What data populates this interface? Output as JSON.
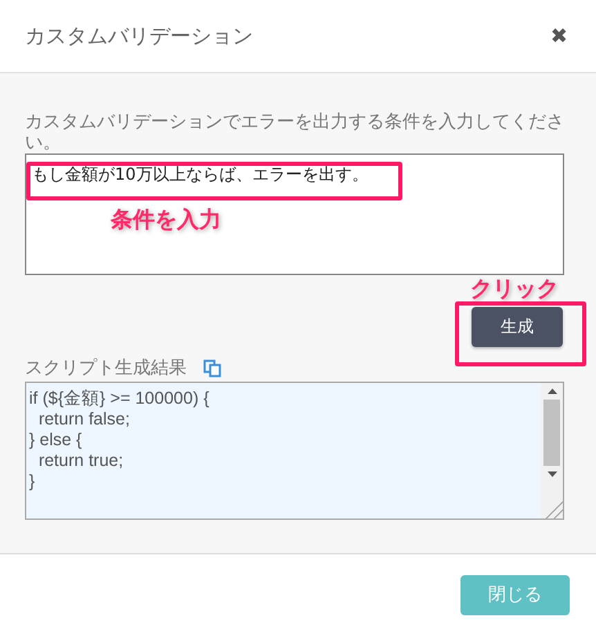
{
  "dialog": {
    "title": "カスタムバリデーション",
    "close": "✖"
  },
  "condition": {
    "label": "カスタムバリデーションでエラーを出力する条件を入力してください。",
    "value": "もし金額が10万以上ならば、エラーを出す。"
  },
  "generate_button": "生成",
  "result": {
    "label": "スクリプト生成結果",
    "value": "if (${金額} >= 100000) {\n  return false;\n} else {\n  return true;\n}"
  },
  "footer": {
    "close_button": "閉じる"
  },
  "annotations": [
    {
      "kind": "field",
      "text": "条件を入力"
    },
    {
      "kind": "button",
      "text": "クリック"
    }
  ]
}
